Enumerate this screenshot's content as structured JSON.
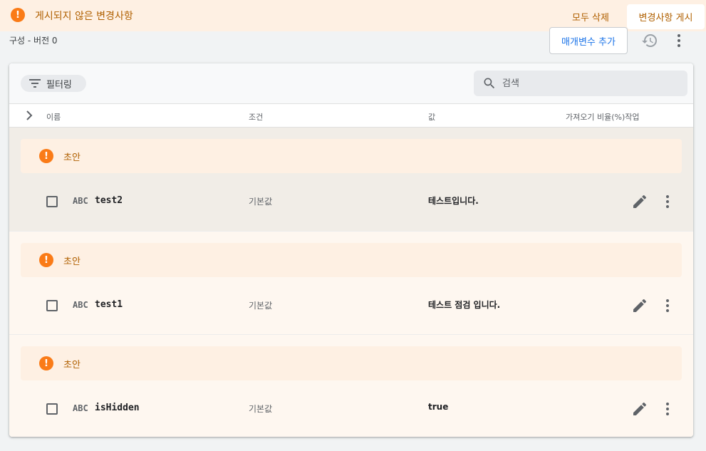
{
  "banner": {
    "message": "게시되지 않은 변경사항",
    "icon": "warning-icon",
    "delete_all_label": "모두 삭제",
    "publish_label": "변경사항 게시"
  },
  "subheader": {
    "config_version": "구성 - 버전 0",
    "add_param_label": "매개변수 추가"
  },
  "toolbar": {
    "filter_label": "필터링",
    "search_placeholder": "검색"
  },
  "table": {
    "columns": {
      "name": "이름",
      "condition": "조건",
      "value": "값",
      "fetch_ratio_actions": "가져오기 비율(%)작업"
    }
  },
  "groups": [
    {
      "draft_label": "초안",
      "type": "ABC",
      "key": "test2",
      "condition": "기본값",
      "value": "테스트입니다."
    },
    {
      "draft_label": "초안",
      "type": "ABC",
      "key": "test1",
      "condition": "기본값",
      "value": "테스트 점검 입니다."
    },
    {
      "draft_label": "초안",
      "type": "ABC",
      "key": "isHidden",
      "condition": "기본값",
      "value": "true"
    }
  ],
  "colors": {
    "warning_orange": "#fa7b17",
    "warning_text": "#b06000",
    "banner_bg": "#fef0e3",
    "accent_blue": "#1a73e8"
  }
}
